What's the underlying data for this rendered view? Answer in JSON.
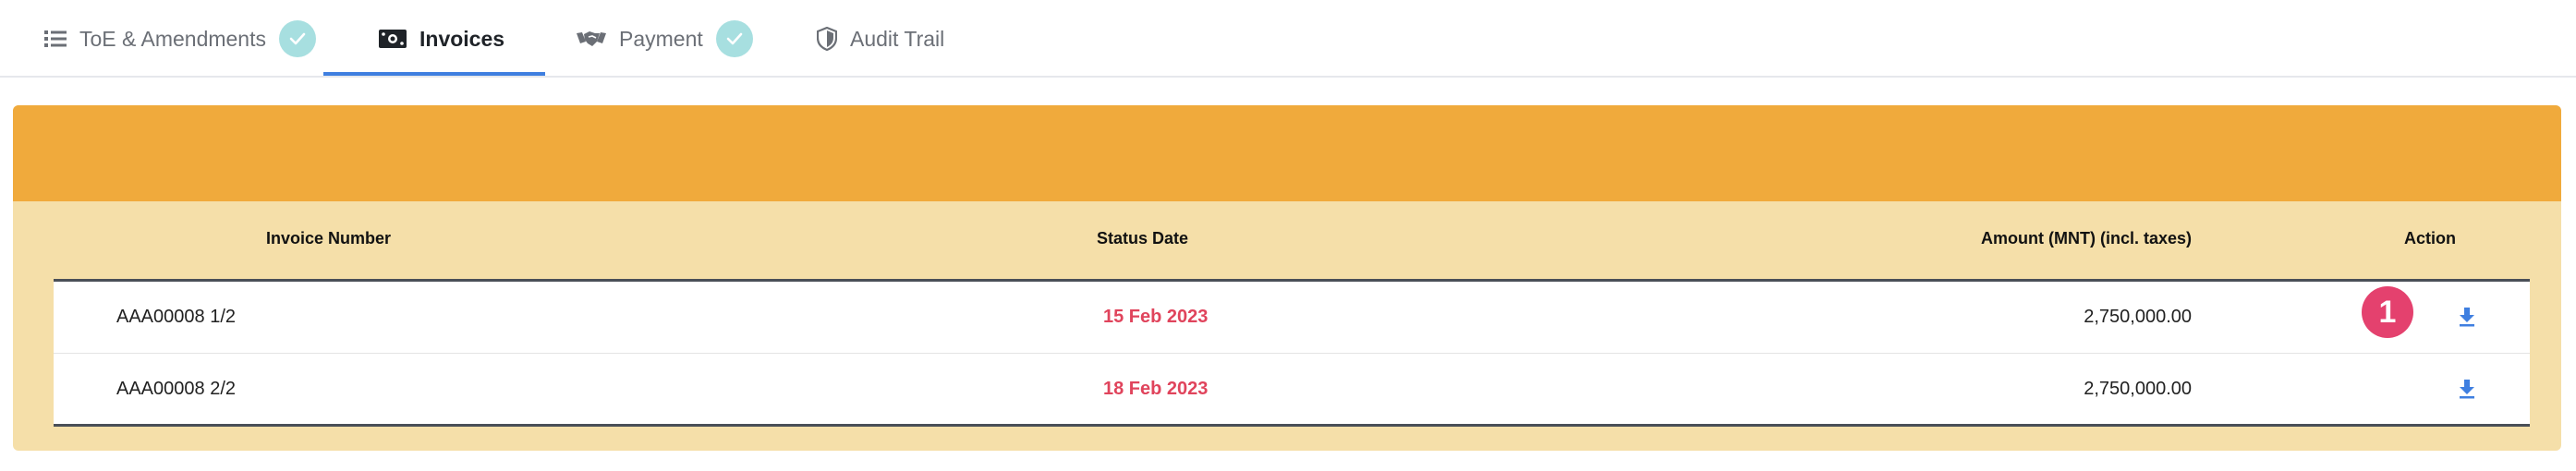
{
  "tabs": [
    {
      "label": "ToE & Amendments",
      "icon": "list-icon",
      "completed": true
    },
    {
      "label": "Invoices",
      "icon": "money-icon",
      "active": true
    },
    {
      "label": "Payment",
      "icon": "handshake-icon",
      "completed": true
    },
    {
      "label": "Audit Trail",
      "icon": "shield-icon"
    }
  ],
  "table": {
    "headers": {
      "invoice_number": "Invoice Number",
      "status_date": "Status Date",
      "amount": "Amount (MNT) (incl. taxes)",
      "action": "Action"
    },
    "rows": [
      {
        "invoice_number": "AAA00008 1/2",
        "status_date": "15 Feb 2023",
        "amount": "2,750,000.00",
        "action_icon": "download-icon"
      },
      {
        "invoice_number": "AAA00008 2/2",
        "status_date": "18 Feb 2023",
        "amount": "2,750,000.00",
        "action_icon": "download-icon"
      }
    ]
  },
  "annotation_badge": "1",
  "colors": {
    "panel_header": "#f0aa3c",
    "panel_body": "#f5dfa9",
    "status_date": "#e0445c",
    "tab_active_underline": "#3f7fe0",
    "check_badge": "#a7dfe0",
    "annotation_badge": "#e4416e",
    "download_icon": "#3f7fe0"
  }
}
